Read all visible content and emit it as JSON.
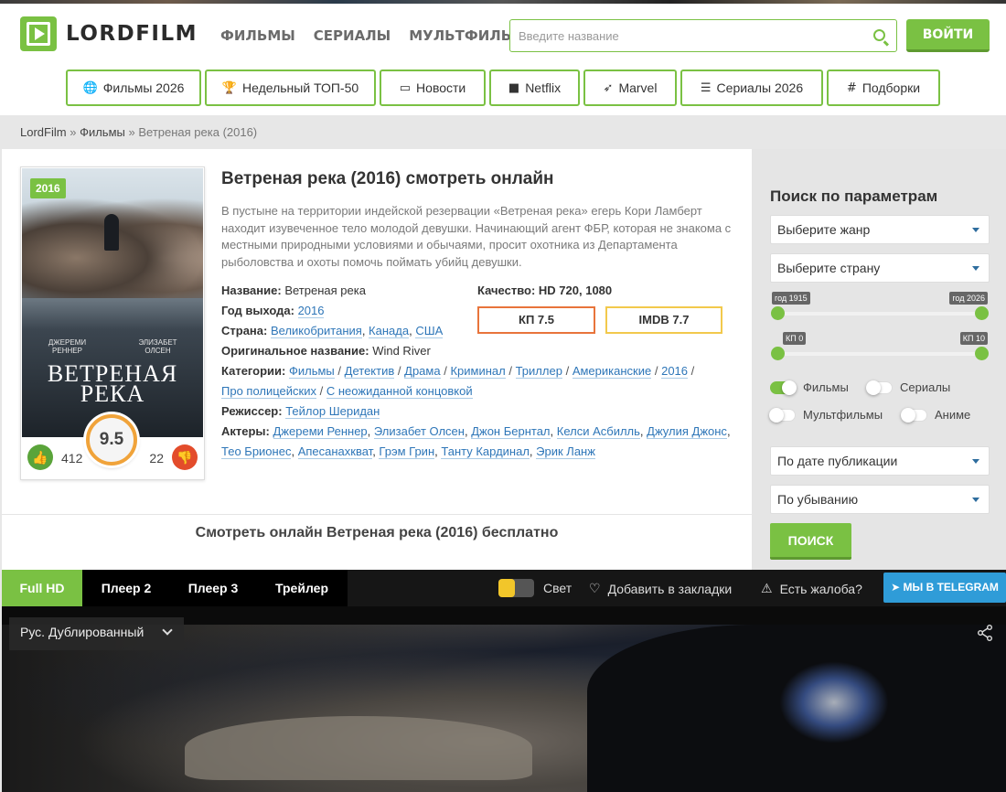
{
  "colors": {
    "accent": "#7ac143",
    "kp": "#e8743b",
    "imdb": "#f2c94c",
    "telegram": "#2f9cd8",
    "link": "#2e76b8"
  },
  "header": {
    "logo_text": "LORDFILM",
    "nav": [
      "ФИЛЬМЫ",
      "СЕРИАЛЫ",
      "МУЛЬТФИЛЬМЫ"
    ],
    "search_placeholder": "Введите название",
    "login_label": "ВОЙТИ"
  },
  "categories": [
    {
      "label": "Фильмы 2026",
      "icon": "globe-icon",
      "glyph": "🌐"
    },
    {
      "label": "Недельный ТОП-50",
      "icon": "trophy-icon",
      "glyph": "🏆"
    },
    {
      "label": "Новости",
      "icon": "window-icon",
      "glyph": "▭"
    },
    {
      "label": "Netflix",
      "icon": "video-camera-icon",
      "glyph": "■"
    },
    {
      "label": "Marvel",
      "icon": "rocket-icon",
      "glyph": "➶"
    },
    {
      "label": "Сериалы 2026",
      "icon": "list-icon",
      "glyph": "☰"
    },
    {
      "label": "Подборки",
      "icon": "hashtag-icon",
      "glyph": "#"
    }
  ],
  "breadcrumb": {
    "home": "LordFilm",
    "section": "Фильмы",
    "current": "Ветреная река (2016)",
    "sep": "»"
  },
  "film": {
    "title": "Ветреная река (2016) смотреть онлайн",
    "description": "В пустыне на территории индейской резервации «Ветреная река» егерь Кори Ламберт находит изувеченное тело молодой девушки. Начинающий агент ФБР, которая не знакома с местными природными условиями и обычаями, просит охотника из Департамента рыболовства и охоты помочь поймать убийц девушки.",
    "poster": {
      "year_badge": "2016",
      "actor_left": "ДЖЕРЕМИ РЕННЕР",
      "actor_right": "ЭЛИЗАБЕТ ОЛСЕН",
      "title_line1": "ВЕТРЕНАЯ",
      "title_line2": "РЕКА"
    },
    "rating": {
      "score": "9.5",
      "likes": "412",
      "dislikes": "22"
    },
    "info": {
      "name_label": "Название:",
      "name_value": "Ветреная река",
      "year_label": "Год выхода:",
      "year_value": "2016",
      "country_label": "Страна:",
      "countries": [
        "Великобритания",
        "Канада",
        "США"
      ],
      "original_label": "Оригинальное название:",
      "original_value": "Wind River",
      "categories_label": "Категории:",
      "categories": [
        "Фильмы",
        "Детектив",
        "Драма",
        "Криминал",
        "Триллер",
        "Американские",
        "2016",
        "Про полицейских",
        "С неожиданной концовкой"
      ],
      "director_label": "Режиссер:",
      "director": "Тейлор Шеридан",
      "actors_label": "Актеры:",
      "actors": [
        "Джереми Реннер",
        "Элизабет Олсен",
        "Джон Бернтал",
        "Келси Асбилль",
        "Джулия Джонс",
        "Тео Брионес",
        "Апесанахкват",
        "Грэм Грин",
        "Танту Кардинал",
        "Эрик Ланж"
      ]
    },
    "quality_label": "Качество:",
    "quality_value": "HD 720, 1080",
    "kp": "КП 7.5",
    "imdb": "IMDB 7.7",
    "watch_title": "Смотреть онлайн Ветреная река (2016) бесплатно"
  },
  "sidebar": {
    "title": "Поиск по параметрам",
    "genre_select": "Выберите жанр",
    "country_select": "Выберите страну",
    "year_from": "год 1915",
    "year_to": "год 2026",
    "kp_from": "КП 0",
    "kp_to": "КП 10",
    "toggles": [
      {
        "label": "Фильмы",
        "on": true
      },
      {
        "label": "Сериалы",
        "on": false
      },
      {
        "label": "Мультфильмы",
        "on": false
      },
      {
        "label": "Аниме",
        "on": false
      }
    ],
    "sort_select": "По дате публикации",
    "order_select": "По убыванию",
    "search_button": "ПОИСК"
  },
  "player": {
    "tabs": [
      "Full HD",
      "Плеер 2",
      "Плеер 3",
      "Трейлер"
    ],
    "light_label": "Свет",
    "bookmark_label": "Добавить в закладки",
    "complaint_label": "Есть жалоба?",
    "telegram_label": "МЫ В TELEGRAM",
    "dub_label": "Рус. Дублированный"
  }
}
